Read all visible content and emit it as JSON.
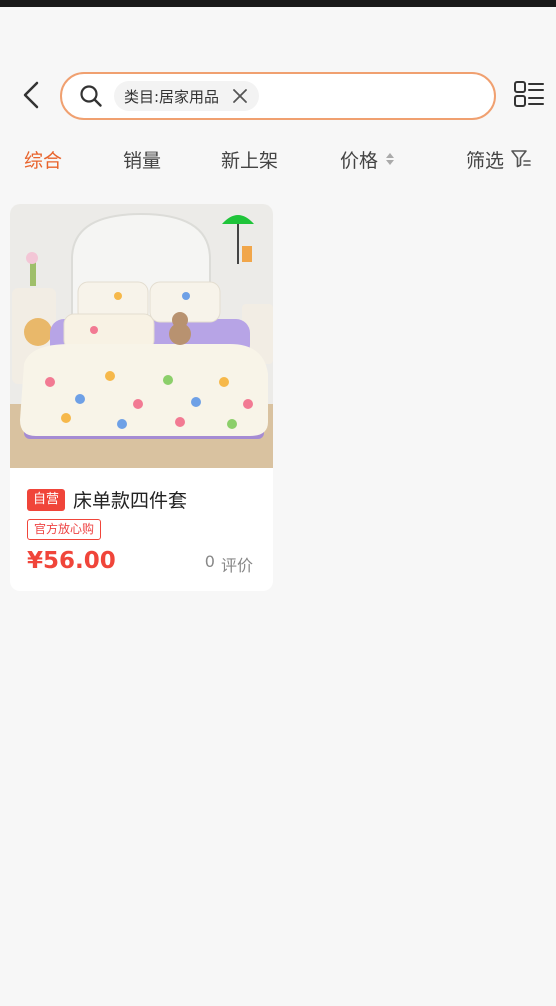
{
  "header": {
    "search_chip_label": "类目:居家用品"
  },
  "sort_bar": {
    "items": [
      {
        "label": "综合",
        "active": true
      },
      {
        "label": "销量",
        "active": false
      },
      {
        "label": "新上架",
        "active": false
      },
      {
        "label": "价格",
        "active": false
      },
      {
        "label": "筛选",
        "active": false
      }
    ]
  },
  "products": [
    {
      "badge": "自营",
      "title": "床单款四件套",
      "tag": "官方放心购",
      "price": "¥56.00",
      "review_count": "0",
      "review_label": "评价"
    }
  ],
  "colors": {
    "accent": "#e8642c",
    "search_border": "#f0a070",
    "price_red": "#f0453a",
    "background": "#f7f7f7"
  },
  "icons": {
    "back": "chevron-left-icon",
    "search": "search-icon",
    "clear": "close-icon",
    "layout": "list-layout-icon",
    "filter": "filter-icon",
    "sort": "sort-caret-icon"
  }
}
